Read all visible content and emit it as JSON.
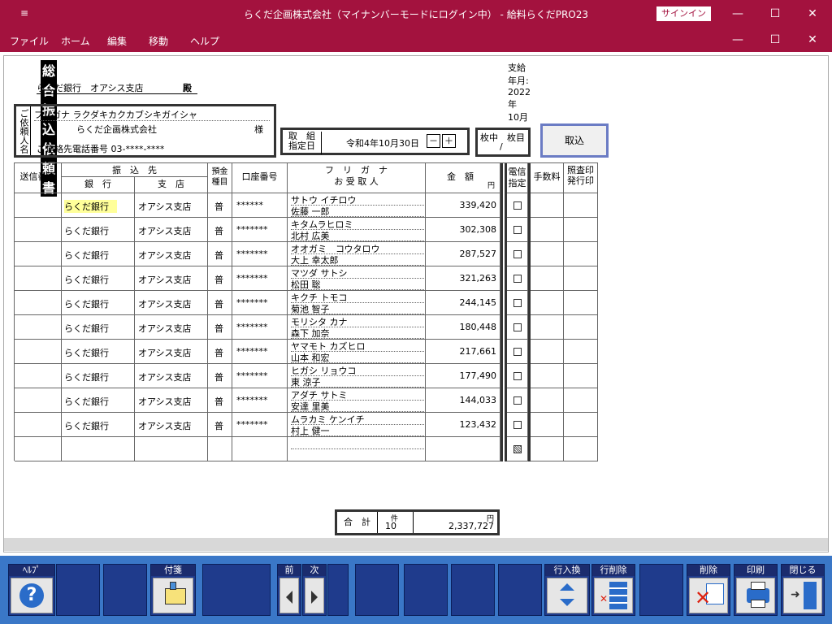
{
  "window": {
    "title": "らくだ企画株式会社（マイナンバーモードにログイン中） - 給料らくだPRO23",
    "signin": "サインイン",
    "sys": "≡",
    "min": "—",
    "max": "☐",
    "close": "✕"
  },
  "menu": [
    "ファイル",
    "ホーム",
    "編集",
    "移動",
    "ヘルプ"
  ],
  "doc": {
    "title": "総合振込依頼書",
    "pay_month_label": "支給年月:",
    "pay_month_value": "2022年 10月",
    "bank_to": "らくだ銀行　オアシス支店",
    "dono": "殿",
    "requester_label": "ご依頼人名",
    "furigana_label": "フリガナ",
    "furigana_value": "ラクダキカクカブシキガイシャ",
    "company": "らくだ企画株式会社",
    "sama": "様",
    "phone_label": "ご連絡先電話番号",
    "phone_value": "03-****-****",
    "date_label1": "取　組",
    "date_label2": "指定日",
    "date_value": "令和4年10月30日",
    "date_minus": "－",
    "date_plus": "＋",
    "sheet_label": "枚中　枚目",
    "sheet_slash": "/",
    "torikomi": "取込"
  },
  "table": {
    "headers": {
      "send_no": "送信番号",
      "dest": "振　込　先",
      "bank": "銀　行",
      "branch": "支　店",
      "type": "預金種目",
      "account": "口座番号",
      "kana_title": "フ　リ　ガ　ナ",
      "recipient": "お 受 取 人",
      "amount": "金　額",
      "yen": "円",
      "denshin": "電信指定",
      "fee": "手数料",
      "shokai": "照査印発行印"
    },
    "rows": [
      {
        "bank": "らくだ銀行",
        "branch": "オアシス支店",
        "type": "普",
        "account": "******",
        "kana": "サトウ イチロウ",
        "name": "佐藤 一郎",
        "amount": "339,420"
      },
      {
        "bank": "らくだ銀行",
        "branch": "オアシス支店",
        "type": "普",
        "account": "*******",
        "kana": "キタムラヒロミ",
        "name": "北村 広美",
        "amount": "302,308"
      },
      {
        "bank": "らくだ銀行",
        "branch": "オアシス支店",
        "type": "普",
        "account": "*******",
        "kana": "オオガミ　コウタロウ",
        "name": "大上 幸太郎",
        "amount": "287,527"
      },
      {
        "bank": "らくだ銀行",
        "branch": "オアシス支店",
        "type": "普",
        "account": "*******",
        "kana": "マツダ サトシ",
        "name": "松田 聡",
        "amount": "321,263"
      },
      {
        "bank": "らくだ銀行",
        "branch": "オアシス支店",
        "type": "普",
        "account": "*******",
        "kana": "キクチ トモコ",
        "name": "菊池 智子",
        "amount": "244,145"
      },
      {
        "bank": "らくだ銀行",
        "branch": "オアシス支店",
        "type": "普",
        "account": "*******",
        "kana": "モリシタ カナ",
        "name": "森下 加奈",
        "amount": "180,448"
      },
      {
        "bank": "らくだ銀行",
        "branch": "オアシス支店",
        "type": "普",
        "account": "*******",
        "kana": "ヤマモト カズヒロ",
        "name": "山本 和宏",
        "amount": "217,661"
      },
      {
        "bank": "らくだ銀行",
        "branch": "オアシス支店",
        "type": "普",
        "account": "*******",
        "kana": "ヒガシ リョウコ",
        "name": "東 涼子",
        "amount": "177,490"
      },
      {
        "bank": "らくだ銀行",
        "branch": "オアシス支店",
        "type": "普",
        "account": "*******",
        "kana": "アダチ サトミ",
        "name": "安達 里美",
        "amount": "144,033"
      },
      {
        "bank": "らくだ銀行",
        "branch": "オアシス支店",
        "type": "普",
        "account": "*******",
        "kana": "ムラカミ ケンイチ",
        "name": "村上 健一",
        "amount": "123,432"
      }
    ],
    "total": {
      "label": "合　計",
      "count": "10",
      "ken": "件",
      "yen": "円",
      "amount": "2,337,727"
    }
  },
  "footer": {
    "help": "ﾍﾙﾌﾟ",
    "fusen": "付箋",
    "prev": "前",
    "next": "次",
    "row_swap": "行入換",
    "row_delete": "行削除",
    "delete": "削除",
    "print": "印刷",
    "close": "閉じる",
    "help_icon": "question-icon"
  }
}
